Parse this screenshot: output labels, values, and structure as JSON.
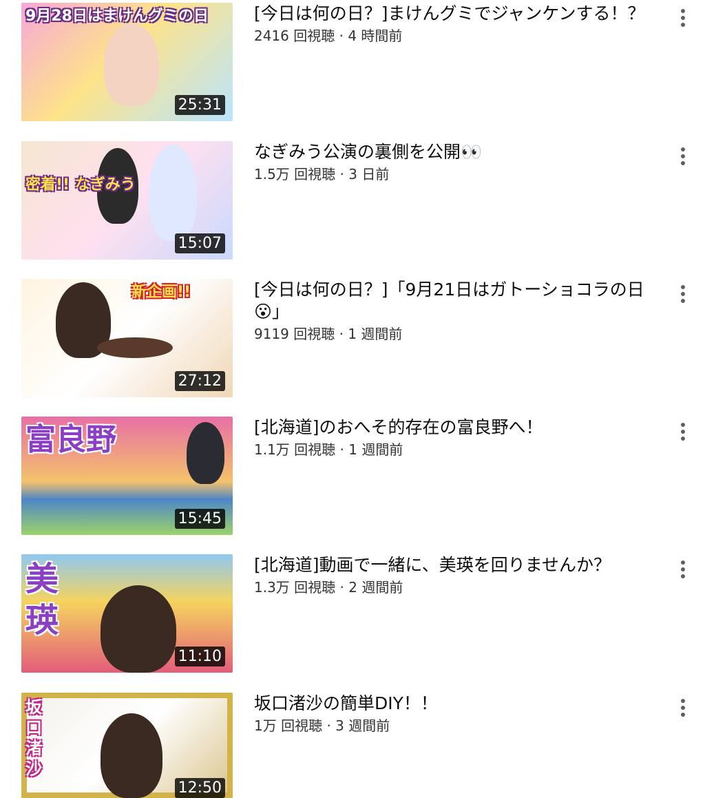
{
  "videos": [
    {
      "title": "[今日は何の日？]まけんグミでジャンケンする！？",
      "views": "2416 回視聴",
      "age": "4 時間前",
      "duration": "25:31",
      "thumb_text": "9月28日はまけんグミの日",
      "thumb_colors": [
        "#f7a8d8",
        "#b9e4ff"
      ]
    },
    {
      "title": "なぎみう公演の裏側を公開👀",
      "views": "1.5万 回視聴",
      "age": "3 日前",
      "duration": "15:07",
      "thumb_text": "密着!! なぎみう",
      "thumb_colors": [
        "#f5e6d0",
        "#c9d9ff"
      ]
    },
    {
      "title": "[今日は何の日？]「9月21日はガトーショコラの日😮」",
      "views": "9119 回視聴",
      "age": "1 週間前",
      "duration": "27:12",
      "thumb_text": "新企画!!",
      "thumb_colors": [
        "#fff4e0",
        "#f0d6b5"
      ]
    },
    {
      "title": "[北海道]のおへそ的存在の富良野へ！",
      "views": "1.1万 回視聴",
      "age": "1 週間前",
      "duration": "15:45",
      "thumb_text": "富良野",
      "thumb_colors": [
        "#9bd36a",
        "#e86fa5"
      ]
    },
    {
      "title": "[北海道]動画で一緒に、美瑛を回りませんか？",
      "views": "1.3万 回視聴",
      "age": "2 週間前",
      "duration": "11:10",
      "thumb_text": "美瑛",
      "thumb_colors": [
        "#f5d35e",
        "#e35d7a"
      ]
    },
    {
      "title": "坂口渚沙の簡単DIY！！",
      "views": "1万 回視聴",
      "age": "3 週間前",
      "duration": "12:50",
      "thumb_text": "坂口渚沙",
      "thumb_colors": [
        "#f4f1ea",
        "#d9c38a"
      ]
    }
  ],
  "stats_separator": " · ",
  "icons": {
    "more": "more-vert-icon"
  }
}
